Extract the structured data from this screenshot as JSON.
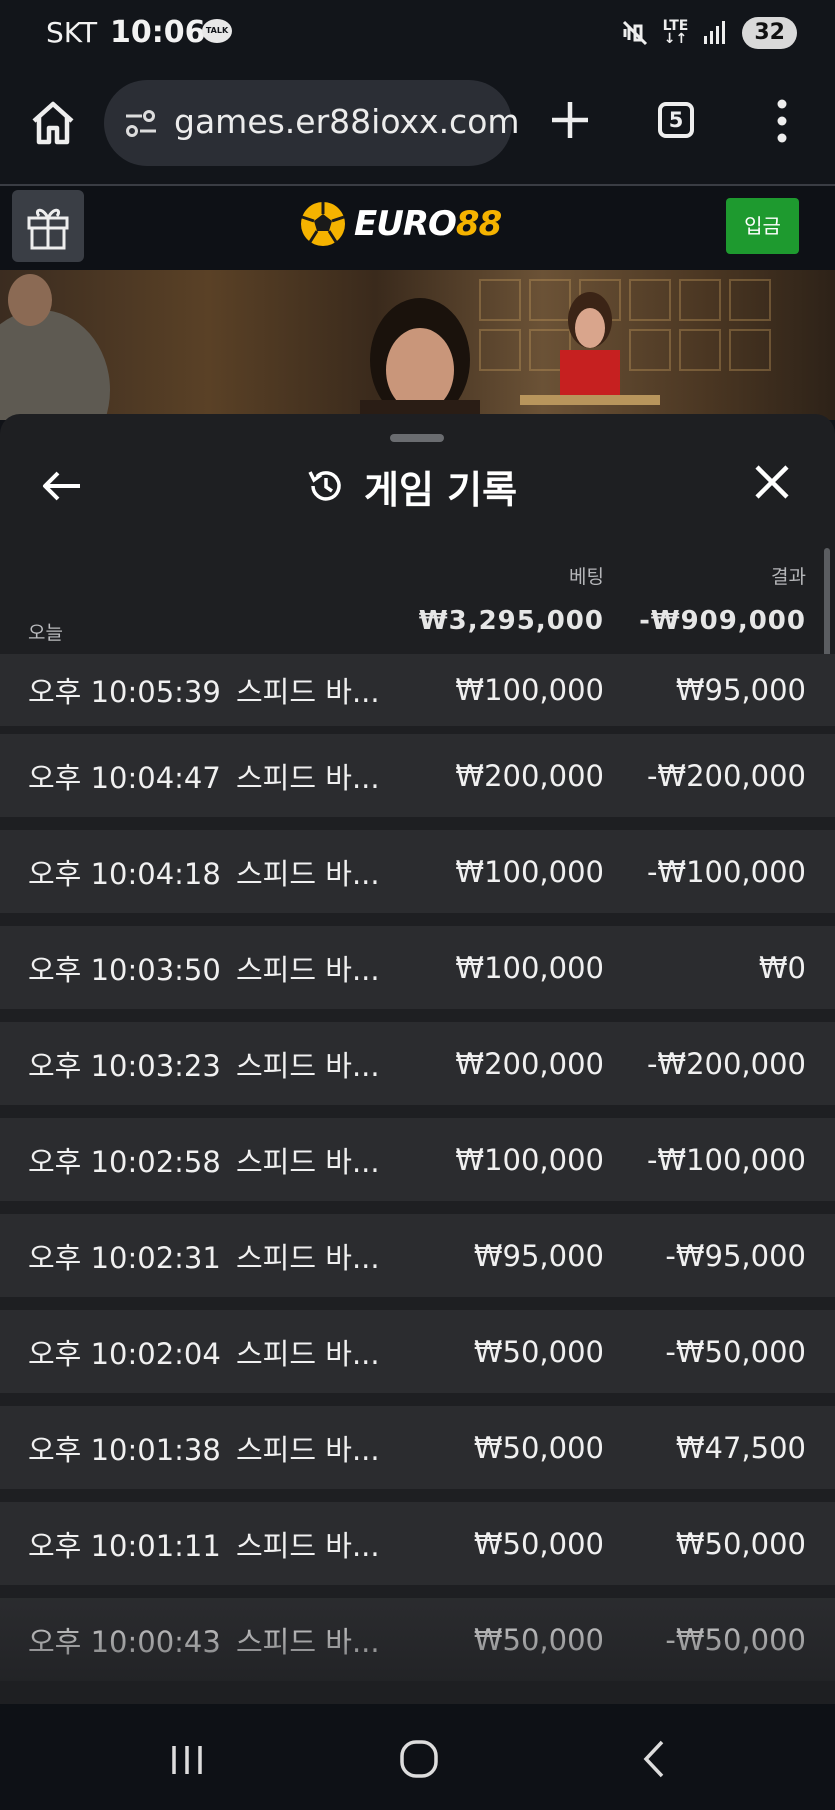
{
  "status_bar": {
    "carrier": "SKT",
    "time": "10:06",
    "kakao_badge": "TALK",
    "network": "LTE",
    "battery": "32"
  },
  "browser": {
    "url": "games.er88ioxx.com",
    "tab_count": "5"
  },
  "site": {
    "logo_text": "EURO",
    "logo_number": "88",
    "deposit_label": "입금"
  },
  "history": {
    "title": "게임 기록",
    "col_bet": "베팅",
    "col_result": "결과",
    "today_label": "오늘",
    "total_bet": "₩3,295,000",
    "total_result": "-₩909,000",
    "rows": [
      {
        "time": "오후 10:05:39",
        "game": "스피드 바...",
        "bet": "₩100,000",
        "result": "₩95,000"
      },
      {
        "time": "오후 10:04:47",
        "game": "스피드 바...",
        "bet": "₩200,000",
        "result": "-₩200,000"
      },
      {
        "time": "오후 10:04:18",
        "game": "스피드 바...",
        "bet": "₩100,000",
        "result": "-₩100,000"
      },
      {
        "time": "오후 10:03:50",
        "game": "스피드 바...",
        "bet": "₩100,000",
        "result": "₩0"
      },
      {
        "time": "오후 10:03:23",
        "game": "스피드 바...",
        "bet": "₩200,000",
        "result": "-₩200,000"
      },
      {
        "time": "오후 10:02:58",
        "game": "스피드 바...",
        "bet": "₩100,000",
        "result": "-₩100,000"
      },
      {
        "time": "오후 10:02:31",
        "game": "스피드 바...",
        "bet": "₩95,000",
        "result": "-₩95,000"
      },
      {
        "time": "오후 10:02:04",
        "game": "스피드 바...",
        "bet": "₩50,000",
        "result": "-₩50,000"
      },
      {
        "time": "오후 10:01:38",
        "game": "스피드 바...",
        "bet": "₩50,000",
        "result": "₩47,500"
      },
      {
        "time": "오후 10:01:11",
        "game": "스피드 바...",
        "bet": "₩50,000",
        "result": "₩50,000"
      },
      {
        "time": "오후 10:00:43",
        "game": "스피드 바...",
        "bet": "₩50,000",
        "result": "-₩50,000"
      }
    ]
  },
  "icons": {
    "home": "home-icon",
    "tune": "site-settings-icon",
    "plus": "plus-icon",
    "menu": "more-vert-icon",
    "gift": "gift-icon",
    "history": "history-icon",
    "back": "arrow-left-icon",
    "close": "close-icon",
    "nav_recent": "recent-apps-icon",
    "nav_home": "home-circle-icon",
    "nav_back": "chevron-left-icon"
  },
  "colors": {
    "deposit_green": "#1e9a2f",
    "logo_gold": "#f5b300",
    "panel_bg": "#1e1f22",
    "row_bg": "#2b2c2f"
  }
}
